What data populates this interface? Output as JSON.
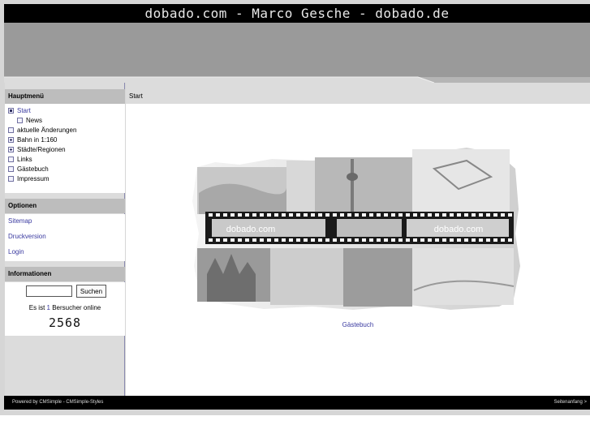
{
  "header": {
    "title": "dobado.com - Marco Gesche - dobado.de"
  },
  "sidebar": {
    "main_menu_heading": "Hauptmenü",
    "menu_items": [
      {
        "label": "Start",
        "icon": "bullet-dot-icon",
        "active": true
      },
      {
        "label": "News",
        "icon": "bullet-box-icon",
        "active": false
      },
      {
        "label": "aktuelle Änderungen",
        "icon": "bullet-box-icon",
        "active": false
      },
      {
        "label": "Bahn in 1:160",
        "icon": "expand-plus-icon",
        "active": false
      },
      {
        "label": "Städte/Regionen",
        "icon": "expand-plus-icon",
        "active": false
      },
      {
        "label": "Links",
        "icon": "bullet-box-icon",
        "active": false
      },
      {
        "label": "Gästebuch",
        "icon": "bullet-box-icon",
        "active": false
      },
      {
        "label": "Impressum",
        "icon": "bullet-box-icon",
        "active": false
      }
    ],
    "options_heading": "Optionen",
    "options_links": [
      "Sitemap",
      "Druckversion",
      "Login"
    ],
    "info_heading": "Informationen",
    "search": {
      "value": "",
      "button_label": "Suchen"
    },
    "visitors": {
      "prefix": "Es ist",
      "count": "1",
      "suffix": "Bersucher online"
    },
    "hit_counter": "2568"
  },
  "main": {
    "breadcrumb": "Start",
    "film_labels": [
      "dobado.com",
      "dobado.com"
    ],
    "link": "Gästebuch"
  },
  "footer": {
    "powered_by": "Powered by CMSimple - CMSimple-Styles",
    "top_link": "Seitenanfang  >"
  },
  "colors": {
    "link": "#3a3aa0",
    "bar": "#000000",
    "sidebar": "#dcdcdc",
    "section_head": "#bdbdbd"
  }
}
